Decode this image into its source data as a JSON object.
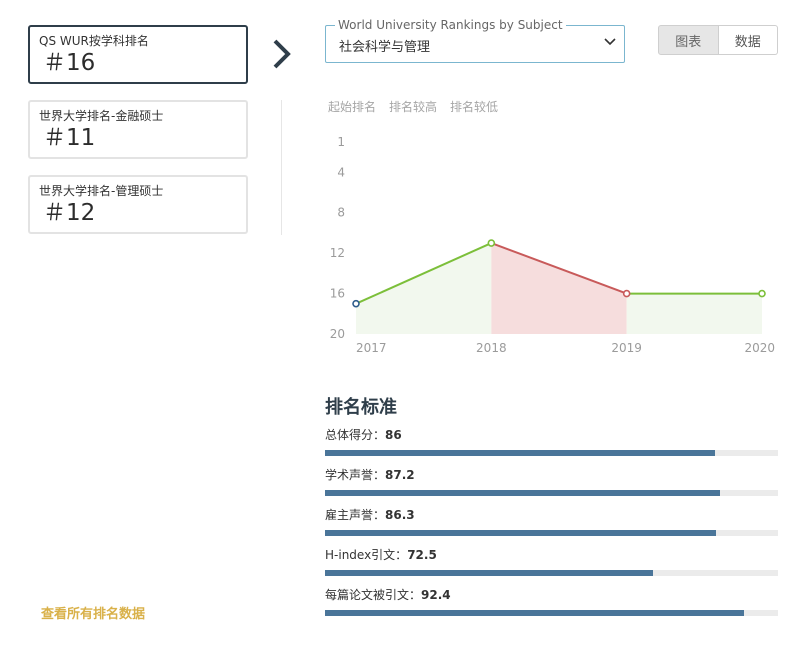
{
  "rank_cards": [
    {
      "label": "QS WUR按学科排名",
      "value": "＃16",
      "active": true
    },
    {
      "label": "世界大学排名-金融硕士",
      "value": "＃11",
      "active": false
    },
    {
      "label": "世界大学排名-管理硕士",
      "value": "＃12",
      "active": false
    }
  ],
  "subject_select": {
    "legend": "World University Rankings by Subject",
    "value": "社会科学与管理"
  },
  "view_toggle": {
    "chart_label": "图表",
    "data_label": "数据",
    "active": "chart"
  },
  "chart_legend": {
    "start": "起始排名",
    "higher": "排名较高",
    "lower": "排名较低"
  },
  "chart_data": {
    "type": "line",
    "x": [
      "2017",
      "2018",
      "2019",
      "2020"
    ],
    "y_ticks": [
      "1",
      "4",
      "8",
      "12",
      "16",
      "20"
    ],
    "ylim": [
      1,
      20
    ],
    "y_inverted": true,
    "series": [
      {
        "values": [
          17,
          11,
          16,
          16
        ]
      }
    ],
    "colors": {
      "start": "#2f5d8c",
      "higher": "#7cbf3a",
      "lower": "#c85a5a",
      "higher_fill": "#f2f8ee",
      "lower_fill": "#f6dddd"
    }
  },
  "criteria": {
    "title": "排名标准",
    "items": [
      {
        "label": "总体得分：",
        "value": "86",
        "score": 86
      },
      {
        "label": "学术声誉：",
        "value": "87.2",
        "score": 87.2
      },
      {
        "label": "雇主声誉：",
        "value": "86.3",
        "score": 86.3
      },
      {
        "label": "H-index引文：",
        "value": "72.5",
        "score": 72.5
      },
      {
        "label": "每篇论文被引文：",
        "value": "92.4",
        "score": 92.4
      }
    ]
  },
  "footer": {
    "view_all": "查看所有排名数据"
  },
  "colors": {
    "accent_dark": "#2f3e4a",
    "bar": "#4a7599",
    "link": "#d9b14a",
    "select_border": "#7bb6cf"
  }
}
